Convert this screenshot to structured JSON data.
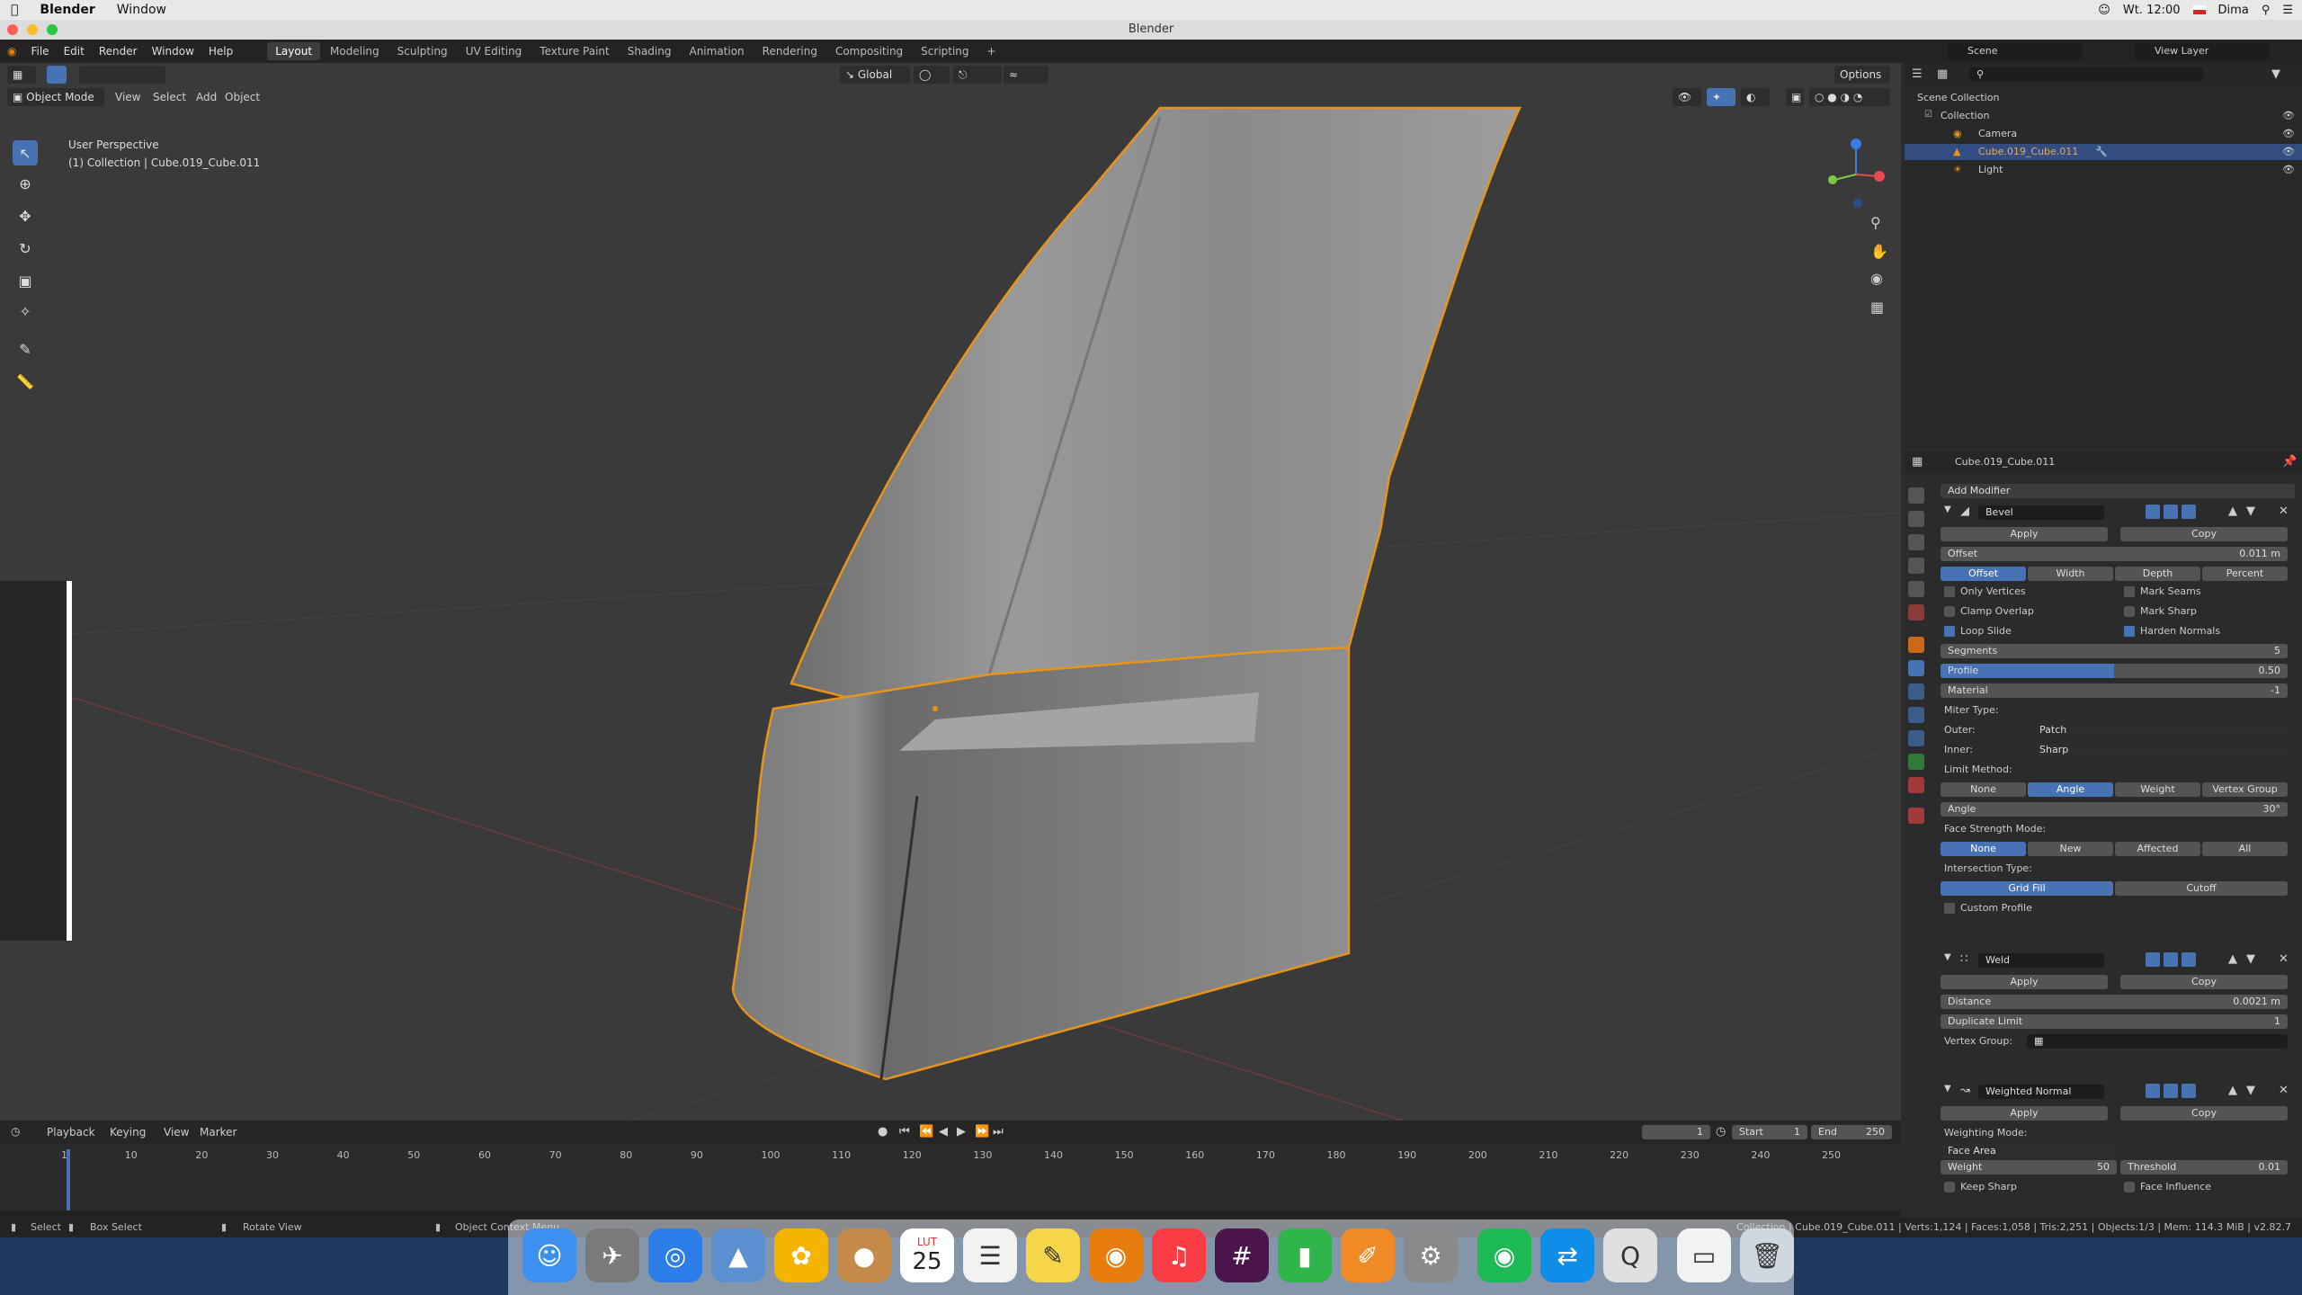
{
  "menubar": {
    "app": "Blender",
    "items": [
      "Window"
    ],
    "clock": "Wt. 12:00",
    "user": "Dima"
  },
  "window": {
    "title": "Blender"
  },
  "topbar": {
    "menus": [
      "File",
      "Edit",
      "Render",
      "Window",
      "Help"
    ],
    "workspaces": [
      "Layout",
      "Modeling",
      "Sculpting",
      "UV Editing",
      "Texture Paint",
      "Shading",
      "Animation",
      "Rendering",
      "Compositing",
      "Scripting",
      "+"
    ],
    "active_workspace": "Layout"
  },
  "viewport": {
    "mode": "Object Mode",
    "menus": [
      "View",
      "Select",
      "Add",
      "Object"
    ],
    "orientation": "Global",
    "options": "Options",
    "info_line1": "User Perspective",
    "info_line2": "(1) Collection | Cube.019_Cube.011"
  },
  "outliner": {
    "scene": "Scene",
    "view_layer": "View Layer",
    "items": [
      {
        "label": "Scene Collection"
      },
      {
        "label": "Collection"
      },
      {
        "label": "Camera"
      },
      {
        "label": "Cube.019_Cube.011"
      },
      {
        "label": "Light"
      }
    ]
  },
  "properties": {
    "object_name": "Cube.019_Cube.011",
    "add_modifier": "Add Modifier",
    "apply": "Apply",
    "copy": "Copy",
    "bevel": {
      "name": "Bevel",
      "offset_label": "Offset",
      "offset_value": "0.011 m",
      "width_types": [
        "Offset",
        "Width",
        "Depth",
        "Percent"
      ],
      "only_vertices": "Only Vertices",
      "clamp_overlap": "Clamp Overlap",
      "loop_slide": "Loop Slide",
      "mark_seams": "Mark Seams",
      "mark_sharp": "Mark Sharp",
      "harden_normals": "Harden Normals",
      "segments_label": "Segments",
      "segments_value": "5",
      "profile_label": "Profile",
      "profile_value": "0.50",
      "profile_fraction": 0.5,
      "material_label": "Material",
      "material_value": "-1",
      "miter_type": "Miter Type:",
      "outer_label": "Outer:",
      "outer_value": "Patch",
      "inner_label": "Inner:",
      "inner_value": "Sharp",
      "limit_method": "Limit Method:",
      "limit_opts": [
        "None",
        "Angle",
        "Weight",
        "Vertex Group"
      ],
      "angle_label": "Angle",
      "angle_value": "30°",
      "face_strength": "Face Strength Mode:",
      "face_opts": [
        "None",
        "New",
        "Affected",
        "All"
      ],
      "intersection": "Intersection Type:",
      "intersection_opts": [
        "Grid Fill",
        "Cutoff"
      ],
      "custom_profile": "Custom Profile"
    },
    "weld": {
      "name": "Weld",
      "distance_label": "Distance",
      "distance_value": "0.0021 m",
      "dup_label": "Duplicate Limit",
      "dup_value": "1",
      "vgroup_label": "Vertex Group:"
    },
    "weighted": {
      "name": "Weighted Normal",
      "mode_label": "Weighting Mode:",
      "mode_value": "Face Area",
      "weight_label": "Weight",
      "weight_value": "50",
      "threshold_label": "Threshold",
      "threshold_value": "0.01",
      "keep_sharp": "Keep Sharp",
      "face_influence": "Face Influence"
    }
  },
  "timeline": {
    "menus": [
      "Playback",
      "Keying",
      "View",
      "Marker"
    ],
    "current_frame": "1",
    "start_label": "Start",
    "start_value": "1",
    "end_label": "End",
    "end_value": "250",
    "ticks": [
      "1",
      "10",
      "20",
      "30",
      "40",
      "50",
      "60",
      "70",
      "80",
      "90",
      "100",
      "110",
      "120",
      "130",
      "140",
      "150",
      "160",
      "170",
      "180",
      "190",
      "200",
      "210",
      "220",
      "230",
      "240",
      "250"
    ]
  },
  "statusbar": {
    "select": "Select",
    "box_select": "Box Select",
    "rotate_view": "Rotate View",
    "context_menu": "Object Context Menu",
    "stats": "Collection | Cube.019_Cube.011 | Verts:1,124 | Faces:1,058 | Tris:2,251 | Objects:1/3 | Mem: 114.3 MiB | v2.82.7"
  },
  "dock": {
    "apps": [
      "finder-icon",
      "launchpad-icon",
      "safari-icon",
      "preview-icon",
      "photos-icon",
      "contacts-icon",
      "calendar-icon",
      "reminders-icon",
      "notes-icon",
      "blender-icon",
      "music-icon",
      "slack-icon",
      "numbers-icon",
      "pages-icon",
      "system-preferences-icon",
      "spotify-icon",
      "teamviewer-icon",
      "qreate-icon",
      "files-icon",
      "trash-icon"
    ],
    "calendar_month": "LUT",
    "calendar_day": "25"
  }
}
